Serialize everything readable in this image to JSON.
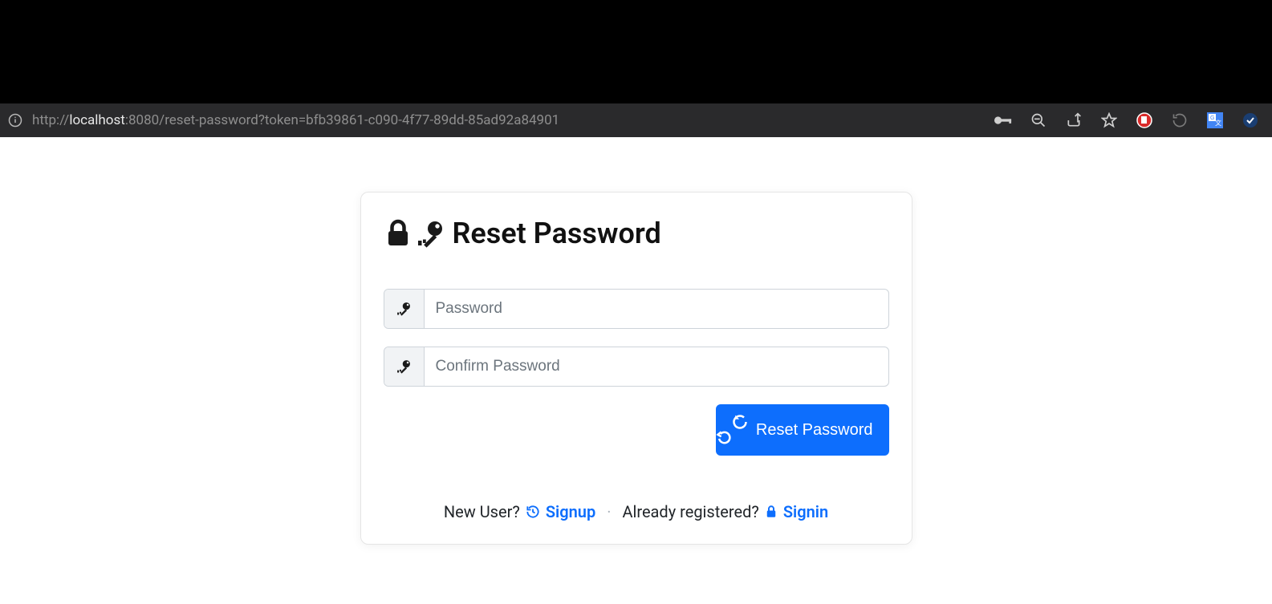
{
  "address_bar": {
    "protocol": "http://",
    "host": "localhost",
    "port_path": ":8080/reset-password?token=bfb39861-c090-4f77-89dd-85ad92a84901"
  },
  "card": {
    "title": "Reset Password",
    "password_placeholder": "Password",
    "confirm_placeholder": "Confirm Password",
    "reset_button": "Reset Password"
  },
  "footer": {
    "new_user_label": "New User?",
    "signup_label": "Signup",
    "separator": "·",
    "already_label": "Already registered?",
    "signin_label": "Signin"
  }
}
